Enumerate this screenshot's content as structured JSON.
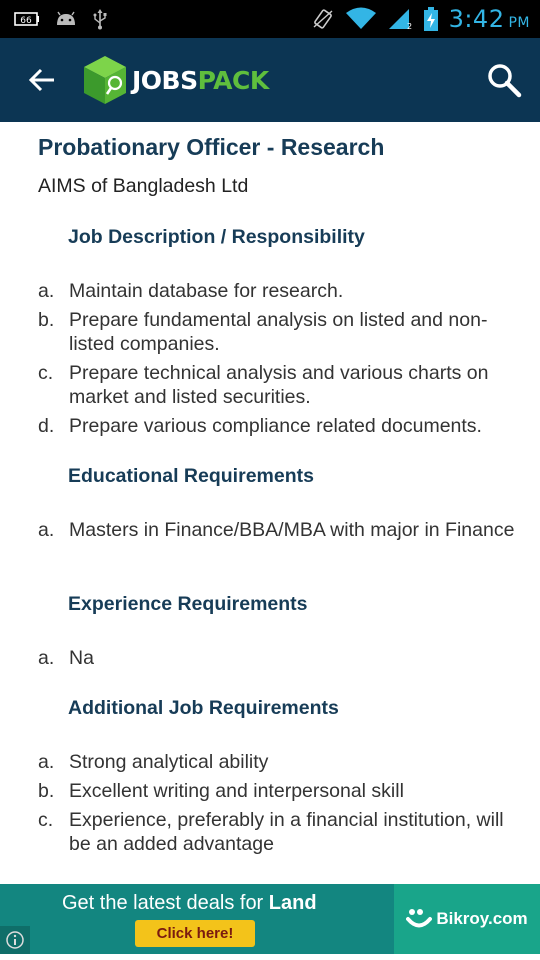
{
  "status_bar": {
    "time": "3:42",
    "ampm": "PM",
    "icons": [
      "battery-saver-icon",
      "android-debug-icon",
      "usb-icon",
      "vibrate-icon",
      "wifi-icon",
      "cellular-signal-icon",
      "battery-charging-icon"
    ]
  },
  "app_bar": {
    "logo_word_white": "JOBS",
    "logo_word_green": "PACK",
    "colors": {
      "bar": "#0c3553",
      "logo_green": "#5fbe3d"
    }
  },
  "job": {
    "title": "Probationary Officer - Research",
    "company": "AIMS of Bangladesh Ltd"
  },
  "sections": {
    "description": {
      "heading": "Job Description / Responsibility",
      "items": [
        {
          "marker": "a.",
          "text": "Maintain database for research."
        },
        {
          "marker": "b.",
          "text": "Prepare fundamental analysis on listed and non-listed companies."
        },
        {
          "marker": "c.",
          "text": "Prepare technical analysis and various charts on market and listed securities."
        },
        {
          "marker": "d.",
          "text": "Prepare various compliance related documents."
        }
      ]
    },
    "education": {
      "heading": "Educational Requirements",
      "items": [
        {
          "marker": "a.",
          "text": "Masters in Finance/BBA/MBA with major in Finance"
        }
      ]
    },
    "experience": {
      "heading": "Experience Requirements",
      "items": [
        {
          "marker": "a.",
          "text": "Na"
        }
      ]
    },
    "additional": {
      "heading": "Additional Job Requirements",
      "items": [
        {
          "marker": "a.",
          "text": "Strong analytical ability"
        },
        {
          "marker": "b.",
          "text": "Excellent writing and interpersonal skill"
        },
        {
          "marker": "c.",
          "text": "Experience, preferably in a financial institution, will be an added advantage"
        }
      ]
    }
  },
  "ad": {
    "text_prefix": "Get the latest deals for ",
    "text_bold": "Land",
    "cta": "Click here!",
    "brand": "Bikroy.com"
  }
}
